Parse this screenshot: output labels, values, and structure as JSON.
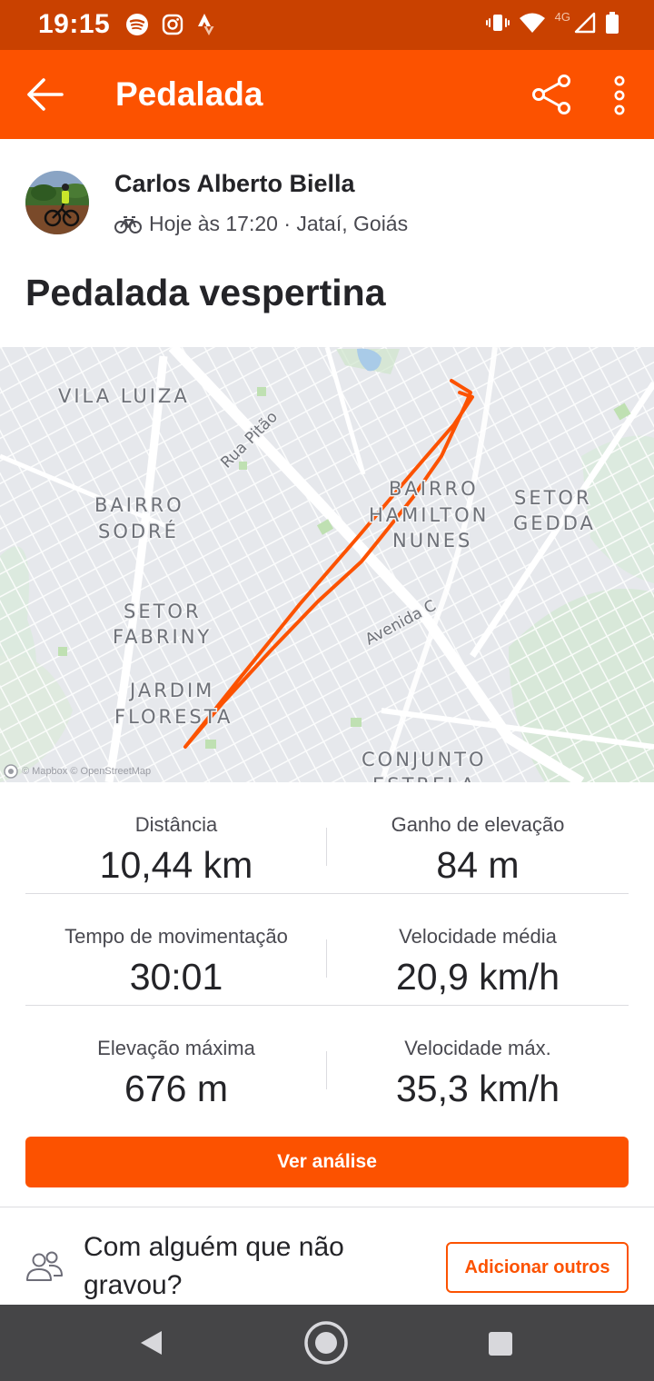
{
  "status_bar": {
    "time": "19:15",
    "network": "4G",
    "left_icons": [
      "spotify-icon",
      "instagram-icon",
      "strava-icon"
    ],
    "right_icons": [
      "vibrate-icon",
      "wifi-icon",
      "signal-icon",
      "battery-icon"
    ]
  },
  "app_bar": {
    "title": "Pedalada",
    "back_icon": "arrow-left-icon",
    "share_icon": "share-icon",
    "more_icon": "more-vertical-icon"
  },
  "header": {
    "athlete_name": "Carlos Alberto Biella",
    "activity_icon": "bike-icon",
    "meta": "Hoje às 17:20 · Jataí, Goiás",
    "activity_title": "Pedalada vespertina"
  },
  "map": {
    "labels": {
      "vila_luiza": "VILA LUIZA",
      "rua_pitao": "Rua Pitão",
      "bairro_sodre_1": "BAIRRO",
      "bairro_sodre_2": "SODRÉ",
      "bairro_hamilton_1": "BAIRRO",
      "bairro_hamilton_2": "HAMILTON",
      "bairro_hamilton_3": "NUNES",
      "setor_gedda_1": "SETOR",
      "setor_gedda_2": "GEDDA",
      "setor_fabriny_1": "SETOR",
      "setor_fabriny_2": "FABRINY",
      "avenida_c": "Avenida C",
      "jardim_floresta_1": "JARDIM",
      "jardim_floresta_2": "FLORESTA",
      "conjunto_estrela_1": "CONJUNTO",
      "conjunto_estrela_2": "ESTRELA"
    },
    "attribution": "© Mapbox © OpenStreetMap",
    "route_color": "#fc5200"
  },
  "stats": [
    {
      "left": {
        "label": "Distância",
        "value": "10,44 km"
      },
      "right": {
        "label": "Ganho de elevação",
        "value": "84 m"
      }
    },
    {
      "left": {
        "label": "Tempo de movimentação",
        "value": "30:01"
      },
      "right": {
        "label": "Velocidade média",
        "value": "20,9 km/h"
      }
    },
    {
      "left": {
        "label": "Elevação máxima",
        "value": "676 m"
      },
      "right": {
        "label": "Velocidade máx.",
        "value": "35,3 km/h"
      }
    }
  ],
  "analysis_button": "Ver análise",
  "with_others": {
    "prompt": "Com alguém que não gravou?",
    "button": "Adicionar outros"
  },
  "colors": {
    "brand": "#fc5200",
    "status_bar": "#c94100",
    "nav_bar": "#454547"
  }
}
